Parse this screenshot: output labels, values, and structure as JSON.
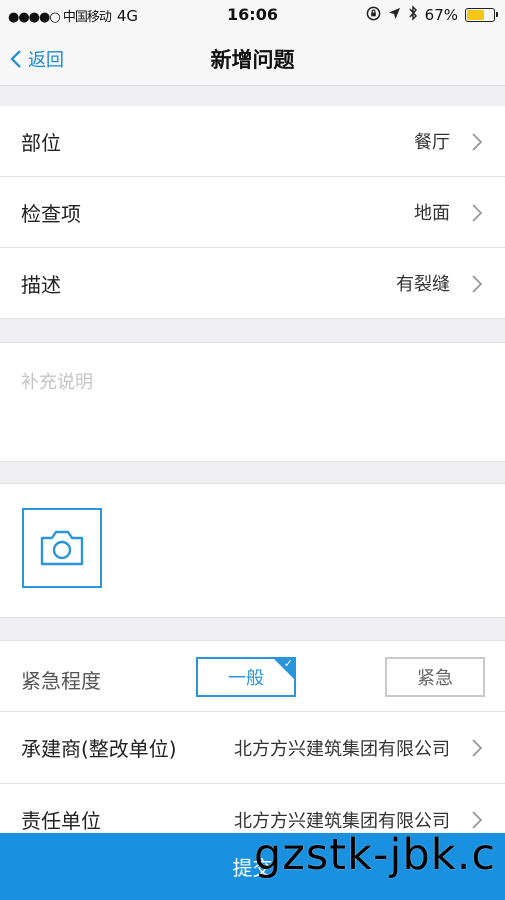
{
  "status_bar": {
    "carrier": "●●●●○ 中国移动",
    "network": "4G",
    "time": "16:06",
    "battery_percent": "67%",
    "battery_level": 0.67,
    "icons": [
      "lock-rotation-icon",
      "location-arrow-icon",
      "bluetooth-icon",
      "battery-icon"
    ]
  },
  "nav": {
    "back_label": "返回",
    "title": "新增问题"
  },
  "form": {
    "rows": [
      {
        "label": "部位",
        "value": "餐厅"
      },
      {
        "label": "检查项",
        "value": "地面"
      },
      {
        "label": "描述",
        "value": "有裂缝"
      }
    ],
    "notes_placeholder": "补充说明",
    "urgency": {
      "label": "紧急程度",
      "options": [
        "一般",
        "紧急"
      ],
      "selected": "一般"
    },
    "contractor": {
      "label": "承建商(整改单位)",
      "value": "北方方兴建筑集团有限公司"
    },
    "responsible": {
      "label": "责任单位",
      "value": "北方方兴建筑集团有限公司"
    }
  },
  "submit_label": "提交",
  "watermark": "gzstk-jbk.c",
  "colors": {
    "accent": "#2a95d8",
    "submit_bg": "#1a90e0",
    "background": "#efeff4",
    "battery": "#f5c518"
  }
}
